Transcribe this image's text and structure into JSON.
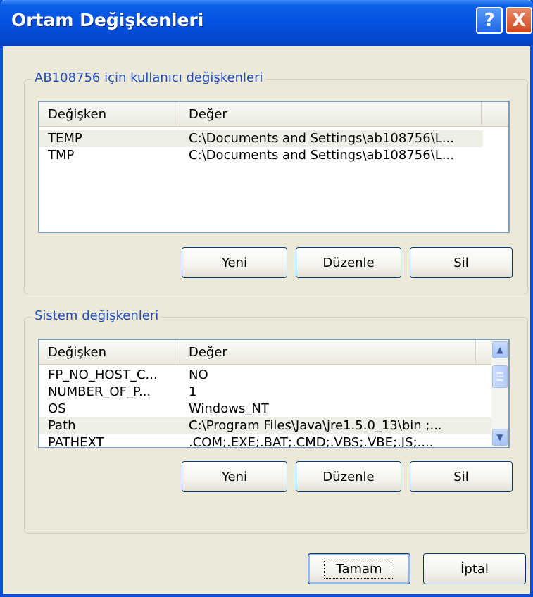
{
  "window": {
    "title": "Ortam Değişkenleri",
    "help_label": "?",
    "close_label": "X"
  },
  "user_vars": {
    "legend": "AB108756 için kullanıcı değişkenleri",
    "columns": [
      "Değişken",
      "Değer"
    ],
    "rows": [
      {
        "name": "TEMP",
        "value": "C:\\Documents and Settings\\ab108756\\L..."
      },
      {
        "name": "TMP",
        "value": "C:\\Documents and Settings\\ab108756\\L..."
      }
    ],
    "buttons": {
      "new": "Yeni",
      "edit": "Düzenle",
      "delete": "Sil"
    }
  },
  "system_vars": {
    "legend": "Sistem değişkenleri",
    "columns": [
      "Değişken",
      "Değer"
    ],
    "rows": [
      {
        "name": "FP_NO_HOST_C...",
        "value": "NO"
      },
      {
        "name": "NUMBER_OF_P...",
        "value": "1"
      },
      {
        "name": "OS",
        "value": "Windows_NT"
      },
      {
        "name": "Path",
        "value": "C:\\Program Files\\Java\\jre1.5.0_13\\bin ;..."
      },
      {
        "name": "PATHEXT",
        "value": ".COM;.EXE;.BAT;.CMD;.VBS;.VBE;.JS;...."
      }
    ],
    "buttons": {
      "new": "Yeni",
      "edit": "Düzenle",
      "delete": "Sil"
    }
  },
  "footer": {
    "ok": "Tamam",
    "cancel": "İptal"
  },
  "colors": {
    "titlebar": "#0551e0",
    "legend_text": "#1f4fc2",
    "dialog_bg": "#ece9d8"
  }
}
